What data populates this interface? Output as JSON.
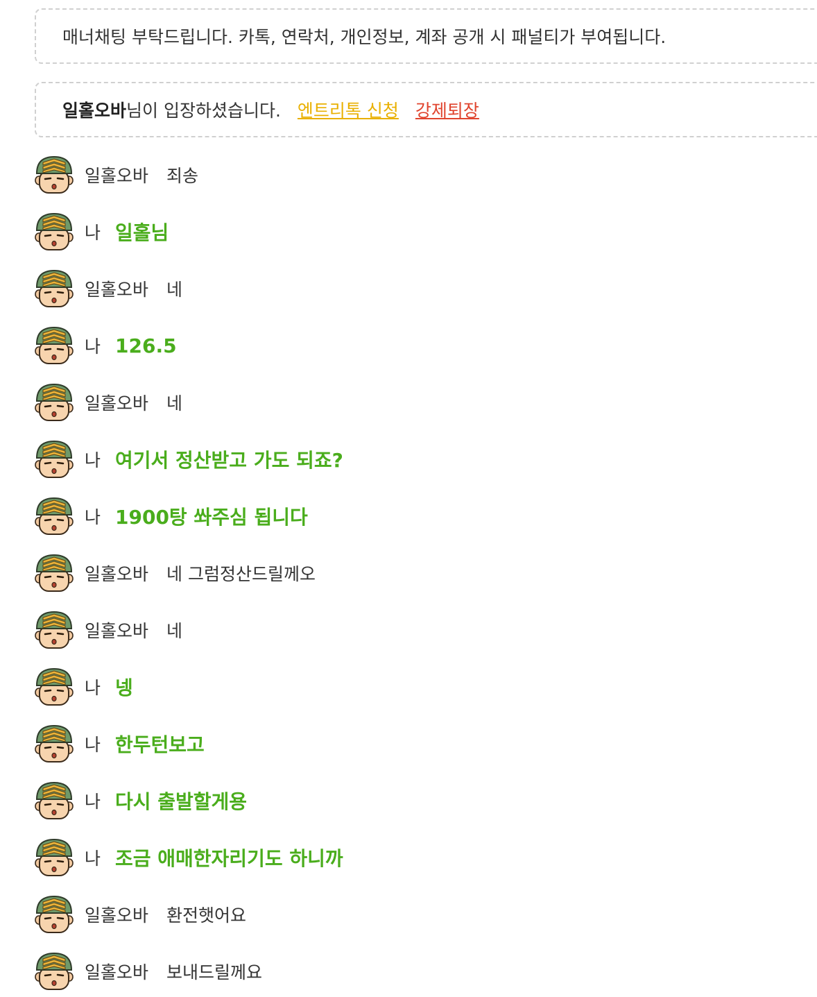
{
  "notices": {
    "rules": "매너채팅 부탁드립니다. 카톡, 연락처, 개인정보, 계좌 공개 시 패널티가 부여됩니다.",
    "entry": {
      "name": "일홀오바",
      "suffix": "님이 입장하셨습니다.",
      "entry_ticket_label": "엔트리톡 신청",
      "kick_label": "강제퇴장"
    }
  },
  "colors": {
    "my_message": "#4aad1c",
    "entry_ticket_link": "#e9b000",
    "kick_link": "#e0442e"
  },
  "messages": [
    {
      "sender": "일홀오바",
      "text": "죄송",
      "mine": false,
      "avatar": "soldier-avatar-icon"
    },
    {
      "sender": "나",
      "text": "일홀님",
      "mine": true,
      "avatar": "soldier-avatar-icon"
    },
    {
      "sender": "일홀오바",
      "text": "네",
      "mine": false,
      "avatar": "soldier-avatar-icon"
    },
    {
      "sender": "나",
      "text": "126.5",
      "mine": true,
      "avatar": "soldier-avatar-icon"
    },
    {
      "sender": "일홀오바",
      "text": "네",
      "mine": false,
      "avatar": "soldier-avatar-icon"
    },
    {
      "sender": "나",
      "text": "여기서 정산받고 가도 되죠?",
      "mine": true,
      "avatar": "soldier-avatar-icon"
    },
    {
      "sender": "나",
      "text": "1900탕 쏴주심 됩니다",
      "mine": true,
      "avatar": "soldier-avatar-icon"
    },
    {
      "sender": "일홀오바",
      "text": "네 그럼정산드릴께오",
      "mine": false,
      "avatar": "soldier-avatar-icon"
    },
    {
      "sender": "일홀오바",
      "text": "네",
      "mine": false,
      "avatar": "soldier-avatar-icon"
    },
    {
      "sender": "나",
      "text": "넹",
      "mine": true,
      "avatar": "soldier-avatar-icon"
    },
    {
      "sender": "나",
      "text": "한두턴보고",
      "mine": true,
      "avatar": "soldier-avatar-icon"
    },
    {
      "sender": "나",
      "text": "다시 출발할게용",
      "mine": true,
      "avatar": "soldier-avatar-icon"
    },
    {
      "sender": "나",
      "text": "조금 애매한자리기도 하니까",
      "mine": true,
      "avatar": "soldier-avatar-icon"
    },
    {
      "sender": "일홀오바",
      "text": "환전햇어요",
      "mine": false,
      "avatar": "soldier-avatar-icon"
    },
    {
      "sender": "일홀오바",
      "text": "보내드릴께요",
      "mine": false,
      "avatar": "soldier-avatar-icon"
    }
  ]
}
